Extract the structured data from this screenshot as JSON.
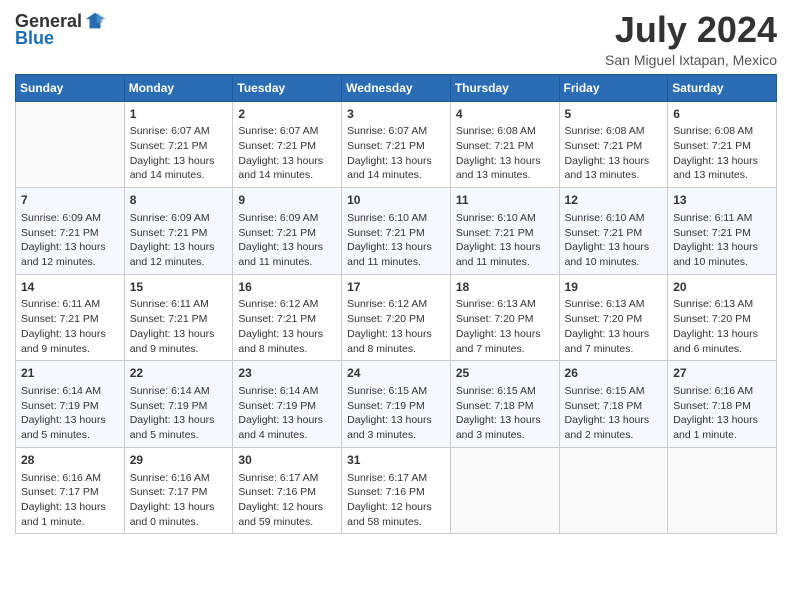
{
  "header": {
    "logo_general": "General",
    "logo_blue": "Blue",
    "month_year": "July 2024",
    "location": "San Miguel Ixtapan, Mexico"
  },
  "weekdays": [
    "Sunday",
    "Monday",
    "Tuesday",
    "Wednesday",
    "Thursday",
    "Friday",
    "Saturday"
  ],
  "weeks": [
    [
      {
        "day": "",
        "info": ""
      },
      {
        "day": "1",
        "info": "Sunrise: 6:07 AM\nSunset: 7:21 PM\nDaylight: 13 hours\nand 14 minutes."
      },
      {
        "day": "2",
        "info": "Sunrise: 6:07 AM\nSunset: 7:21 PM\nDaylight: 13 hours\nand 14 minutes."
      },
      {
        "day": "3",
        "info": "Sunrise: 6:07 AM\nSunset: 7:21 PM\nDaylight: 13 hours\nand 14 minutes."
      },
      {
        "day": "4",
        "info": "Sunrise: 6:08 AM\nSunset: 7:21 PM\nDaylight: 13 hours\nand 13 minutes."
      },
      {
        "day": "5",
        "info": "Sunrise: 6:08 AM\nSunset: 7:21 PM\nDaylight: 13 hours\nand 13 minutes."
      },
      {
        "day": "6",
        "info": "Sunrise: 6:08 AM\nSunset: 7:21 PM\nDaylight: 13 hours\nand 13 minutes."
      }
    ],
    [
      {
        "day": "7",
        "info": "Sunrise: 6:09 AM\nSunset: 7:21 PM\nDaylight: 13 hours\nand 12 minutes."
      },
      {
        "day": "8",
        "info": "Sunrise: 6:09 AM\nSunset: 7:21 PM\nDaylight: 13 hours\nand 12 minutes."
      },
      {
        "day": "9",
        "info": "Sunrise: 6:09 AM\nSunset: 7:21 PM\nDaylight: 13 hours\nand 11 minutes."
      },
      {
        "day": "10",
        "info": "Sunrise: 6:10 AM\nSunset: 7:21 PM\nDaylight: 13 hours\nand 11 minutes."
      },
      {
        "day": "11",
        "info": "Sunrise: 6:10 AM\nSunset: 7:21 PM\nDaylight: 13 hours\nand 11 minutes."
      },
      {
        "day": "12",
        "info": "Sunrise: 6:10 AM\nSunset: 7:21 PM\nDaylight: 13 hours\nand 10 minutes."
      },
      {
        "day": "13",
        "info": "Sunrise: 6:11 AM\nSunset: 7:21 PM\nDaylight: 13 hours\nand 10 minutes."
      }
    ],
    [
      {
        "day": "14",
        "info": "Sunrise: 6:11 AM\nSunset: 7:21 PM\nDaylight: 13 hours\nand 9 minutes."
      },
      {
        "day": "15",
        "info": "Sunrise: 6:11 AM\nSunset: 7:21 PM\nDaylight: 13 hours\nand 9 minutes."
      },
      {
        "day": "16",
        "info": "Sunrise: 6:12 AM\nSunset: 7:21 PM\nDaylight: 13 hours\nand 8 minutes."
      },
      {
        "day": "17",
        "info": "Sunrise: 6:12 AM\nSunset: 7:20 PM\nDaylight: 13 hours\nand 8 minutes."
      },
      {
        "day": "18",
        "info": "Sunrise: 6:13 AM\nSunset: 7:20 PM\nDaylight: 13 hours\nand 7 minutes."
      },
      {
        "day": "19",
        "info": "Sunrise: 6:13 AM\nSunset: 7:20 PM\nDaylight: 13 hours\nand 7 minutes."
      },
      {
        "day": "20",
        "info": "Sunrise: 6:13 AM\nSunset: 7:20 PM\nDaylight: 13 hours\nand 6 minutes."
      }
    ],
    [
      {
        "day": "21",
        "info": "Sunrise: 6:14 AM\nSunset: 7:19 PM\nDaylight: 13 hours\nand 5 minutes."
      },
      {
        "day": "22",
        "info": "Sunrise: 6:14 AM\nSunset: 7:19 PM\nDaylight: 13 hours\nand 5 minutes."
      },
      {
        "day": "23",
        "info": "Sunrise: 6:14 AM\nSunset: 7:19 PM\nDaylight: 13 hours\nand 4 minutes."
      },
      {
        "day": "24",
        "info": "Sunrise: 6:15 AM\nSunset: 7:19 PM\nDaylight: 13 hours\nand 3 minutes."
      },
      {
        "day": "25",
        "info": "Sunrise: 6:15 AM\nSunset: 7:18 PM\nDaylight: 13 hours\nand 3 minutes."
      },
      {
        "day": "26",
        "info": "Sunrise: 6:15 AM\nSunset: 7:18 PM\nDaylight: 13 hours\nand 2 minutes."
      },
      {
        "day": "27",
        "info": "Sunrise: 6:16 AM\nSunset: 7:18 PM\nDaylight: 13 hours\nand 1 minute."
      }
    ],
    [
      {
        "day": "28",
        "info": "Sunrise: 6:16 AM\nSunset: 7:17 PM\nDaylight: 13 hours\nand 1 minute."
      },
      {
        "day": "29",
        "info": "Sunrise: 6:16 AM\nSunset: 7:17 PM\nDaylight: 13 hours\nand 0 minutes."
      },
      {
        "day": "30",
        "info": "Sunrise: 6:17 AM\nSunset: 7:16 PM\nDaylight: 12 hours\nand 59 minutes."
      },
      {
        "day": "31",
        "info": "Sunrise: 6:17 AM\nSunset: 7:16 PM\nDaylight: 12 hours\nand 58 minutes."
      },
      {
        "day": "",
        "info": ""
      },
      {
        "day": "",
        "info": ""
      },
      {
        "day": "",
        "info": ""
      }
    ]
  ]
}
